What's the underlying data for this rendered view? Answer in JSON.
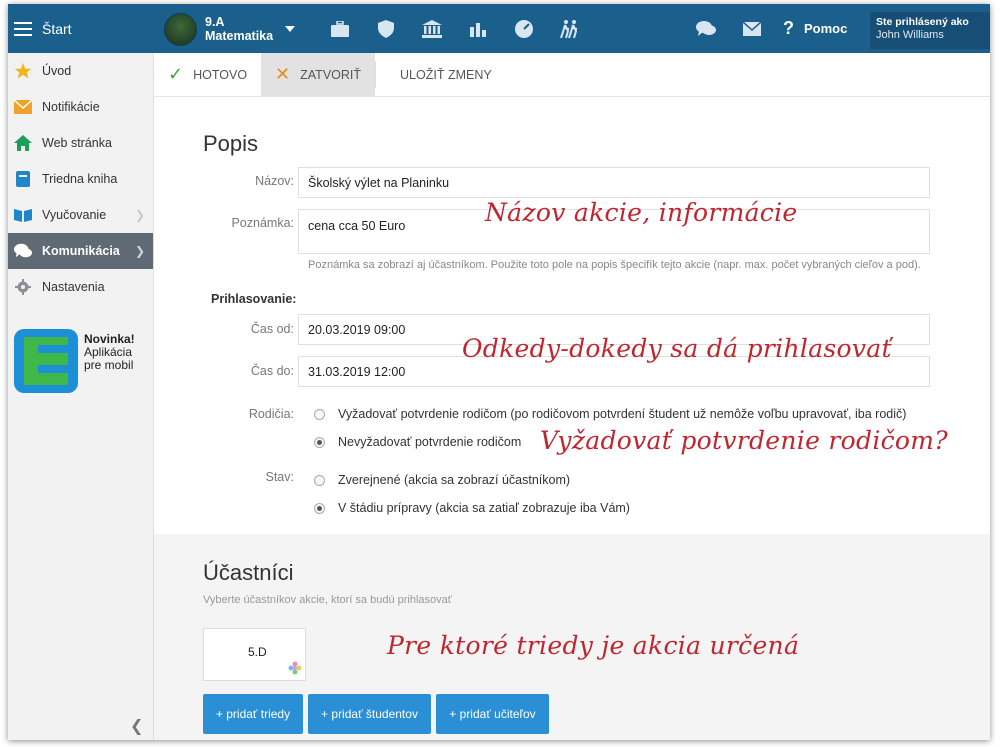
{
  "topbar": {
    "start_label": "Štart",
    "class_name": "9.A",
    "subject": "Matematika",
    "help_label": "Pomoc",
    "user_line1": "Ste prihlásený ako",
    "user_line2": "John Williams",
    "icons": [
      "briefcase-icon",
      "shield-icon",
      "bank-icon",
      "bar-chart-icon",
      "gauge-icon",
      "walking-people-icon"
    ],
    "right_icons": [
      "chat-icon",
      "mail-icon"
    ]
  },
  "sidebar": {
    "items": [
      {
        "label": "Úvod",
        "icon": "star-icon",
        "color": "#f2b51e"
      },
      {
        "label": "Notifikácie",
        "icon": "envelope-icon",
        "color": "#f0a22a"
      },
      {
        "label": "Web stránka",
        "icon": "home-icon",
        "color": "#1b9f5a"
      },
      {
        "label": "Triedna kniha",
        "icon": "book-icon",
        "color": "#1f86cc"
      },
      {
        "label": "Vyučovanie",
        "icon": "open-book-icon",
        "color": "#1f86cc"
      },
      {
        "label": "Komunikácia",
        "icon": "chat-bubbles-icon",
        "color": "#ffffff"
      },
      {
        "label": "Nastavenia",
        "icon": "gear-icon",
        "color": "#8a9096"
      }
    ],
    "promo_title": "Novinka!",
    "promo_line1": "Aplikácia",
    "promo_line2": "pre mobil"
  },
  "toolbar": {
    "done_label": "HOTOVO",
    "close_label": "ZATVORIŤ",
    "save_label": "ULOŽIŤ ZMENY"
  },
  "form": {
    "title": "Popis",
    "name_label": "Názov:",
    "name_value": "Školský výlet na Planinku",
    "note_label": "Poznámka:",
    "note_value": "cena cca 50 Euro",
    "note_hint": "Poznámka sa zobrazí aj účastníkom. Použite toto pole na popis špecifík tejto akcie (napr. max. počet vybraných cieľov a pod).",
    "signup_label": "Prihlasovanie:",
    "from_label": "Čas od:",
    "from_value": "20.03.2019 09:00",
    "to_label": "Čas do:",
    "to_value": "31.03.2019 12:00",
    "parents_label": "Rodičia:",
    "parents_opt1": "Vyžadovať potvrdenie rodičom (po rodičovom potvrdení študent už nemôže voľbu upravovať, iba rodič)",
    "parents_opt2": "Nevyžadovať potvrdenie rodičom",
    "state_label": "Stav:",
    "state_opt1": "Zverejnené (akcia sa zobrazí účastníkom)",
    "state_opt2": "V štádiu prípravy (akcia sa zatiaľ zobrazuje iba Vám)"
  },
  "annotations": {
    "a1": "Názov akcie, informácie",
    "a2": "Odkedy-dokedy sa dá prihlasovať",
    "a3": "Vyžadovať potvrdenie rodičom?",
    "a4": "Pre ktoré triedy je akcia určená"
  },
  "participants": {
    "title": "Účastníci",
    "subtitle": "Vyberte účastníkov akcie, ktorí sa budú prihlasovať",
    "class_card": "5.D",
    "add_classes": "+ pridať triedy",
    "add_students": "+ pridať študentov",
    "add_teachers": "+ pridať učiteľov"
  }
}
